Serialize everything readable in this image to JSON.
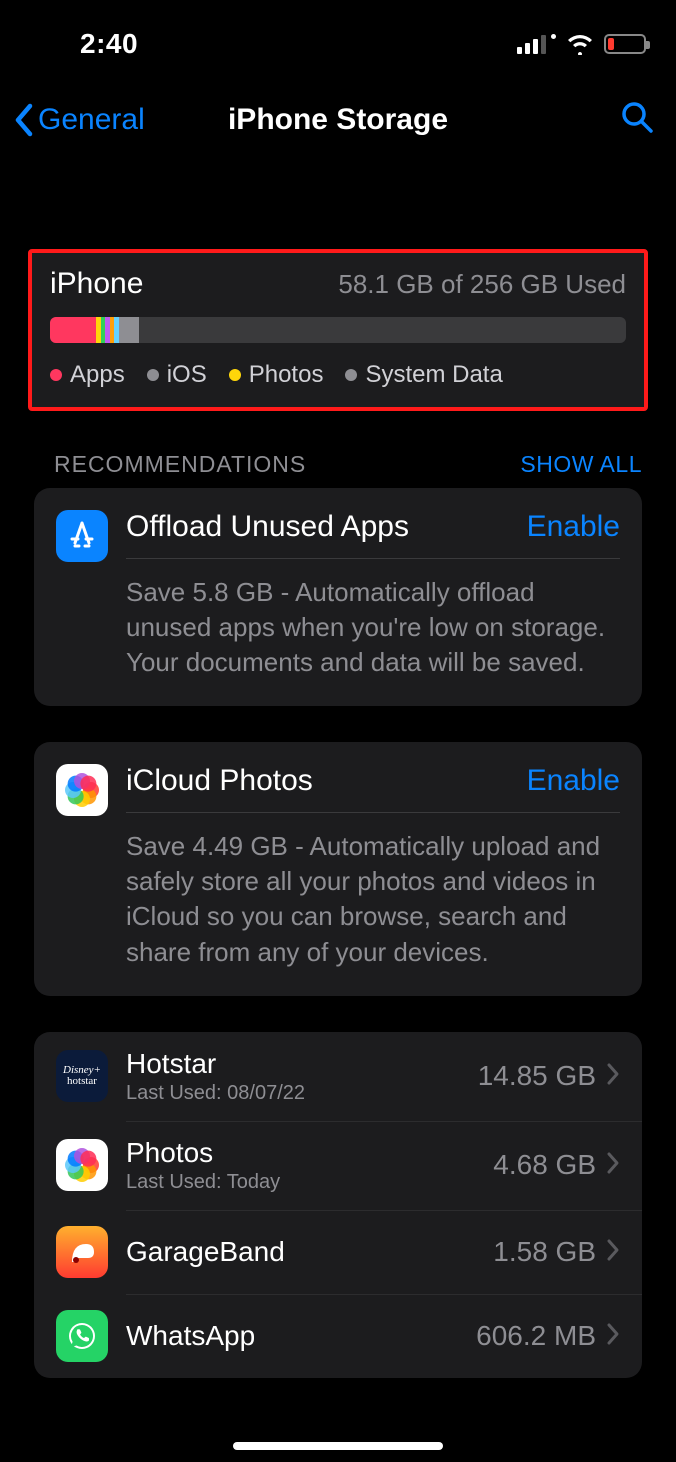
{
  "status": {
    "time": "2:40"
  },
  "nav": {
    "back": "General",
    "title": "iPhone Storage"
  },
  "storage": {
    "device": "iPhone",
    "used_text": "58.1 GB of 256 GB Used",
    "segments": [
      {
        "color": "#ff375f",
        "pct": 8.0
      },
      {
        "color": "#ffd60a",
        "pct": 0.8
      },
      {
        "color": "#30d158",
        "pct": 0.8
      },
      {
        "color": "#bf5af2",
        "pct": 0.8
      },
      {
        "color": "#ff9f0a",
        "pct": 0.8
      },
      {
        "color": "#64d2ff",
        "pct": 0.8
      },
      {
        "color": "#8e8e93",
        "pct": 3.5
      }
    ],
    "legend": [
      {
        "color": "#ff375f",
        "label": "Apps"
      },
      {
        "color": "#8e8e93",
        "label": "iOS"
      },
      {
        "color": "#ffd60a",
        "label": "Photos"
      },
      {
        "color": "#8e8e93",
        "label": "System Data"
      }
    ]
  },
  "recommendations": {
    "header": "RECOMMENDATIONS",
    "show_all": "SHOW ALL",
    "items": [
      {
        "icon": "appstore",
        "title": "Offload Unused Apps",
        "action": "Enable",
        "desc": "Save 5.8 GB - Automatically offload unused apps when you're low on storage. Your documents and data will be saved."
      },
      {
        "icon": "photos",
        "title": "iCloud Photos",
        "action": "Enable",
        "desc": "Save 4.49 GB - Automatically upload and safely store all your photos and videos in iCloud so you can browse, search and share from any of your devices."
      }
    ]
  },
  "apps": [
    {
      "icon": "hotstar",
      "name": "Hotstar",
      "sub": "Last Used: 08/07/22",
      "size": "14.85 GB"
    },
    {
      "icon": "photos",
      "name": "Photos",
      "sub": "Last Used: Today",
      "size": "4.68 GB"
    },
    {
      "icon": "garage",
      "name": "GarageBand",
      "sub": "",
      "size": "1.58 GB"
    },
    {
      "icon": "whatsapp",
      "name": "WhatsApp",
      "sub": "",
      "size": "606.2 MB"
    }
  ]
}
